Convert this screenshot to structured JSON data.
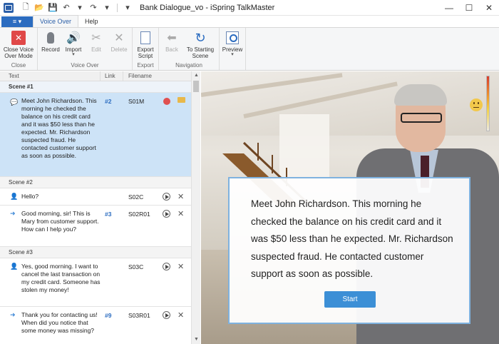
{
  "window": {
    "title": "Bank Dialogue_vo - iSpring TalkMaster",
    "minimize": "—",
    "maximize": "☐",
    "close": "✕"
  },
  "qat": {
    "new": "🗋",
    "open": "📂",
    "save": "💾",
    "undo": "↶",
    "redo": "↷",
    "more": "▾"
  },
  "tabs": {
    "file": "≡ ▾",
    "items": [
      "Voice Over",
      "Help"
    ]
  },
  "ribbon": {
    "groups": [
      {
        "label": "Close",
        "buttons": [
          "Close Voice Over Mode"
        ]
      },
      {
        "label": "Voice Over",
        "buttons": [
          "Record",
          "Import",
          "Edit",
          "Delete"
        ]
      },
      {
        "label": "Export",
        "buttons": [
          "Export Script"
        ]
      },
      {
        "label": "Navigation",
        "buttons": [
          "Back",
          "To Starting Scene"
        ]
      },
      {
        "label": "",
        "buttons": [
          "Preview"
        ]
      }
    ]
  },
  "list": {
    "columns": [
      "Text",
      "Link",
      "Filename"
    ],
    "scenes": [
      {
        "title": "Scene #1",
        "rows": [
          {
            "text": "Meet John Richardson. This morning he checked the balance on his credit card and it was $50 less than he expected. Mr. Richardson suspected fraud. He contacted customer support as soon as possible.",
            "link": "#2",
            "filename": "S01M"
          }
        ]
      },
      {
        "title": "Scene #2",
        "rows": [
          {
            "text": "Hello?",
            "link": "",
            "filename": "S02C"
          },
          {
            "text": "Good morning, sir! This is Mary from customer support. How can I help you?",
            "link": "#3",
            "filename": "S02R01"
          }
        ]
      },
      {
        "title": "Scene #3",
        "rows": [
          {
            "text": "Yes, good morning. I want to cancel the last transaction on my credit card. Someone has stolen my money!",
            "link": "",
            "filename": "S03C"
          },
          {
            "text": "Thank you for contacting us! When did you notice that some money was missing?",
            "link": "#9",
            "filename": "S03R01"
          }
        ]
      }
    ]
  },
  "preview": {
    "dialog_text": "Meet John Richardson. This morning he checked the balance on his credit card and it was $50 less than he expected. Mr. Richardson suspected fraud. He contacted customer support as soon as possible.",
    "start_label": "Start"
  }
}
